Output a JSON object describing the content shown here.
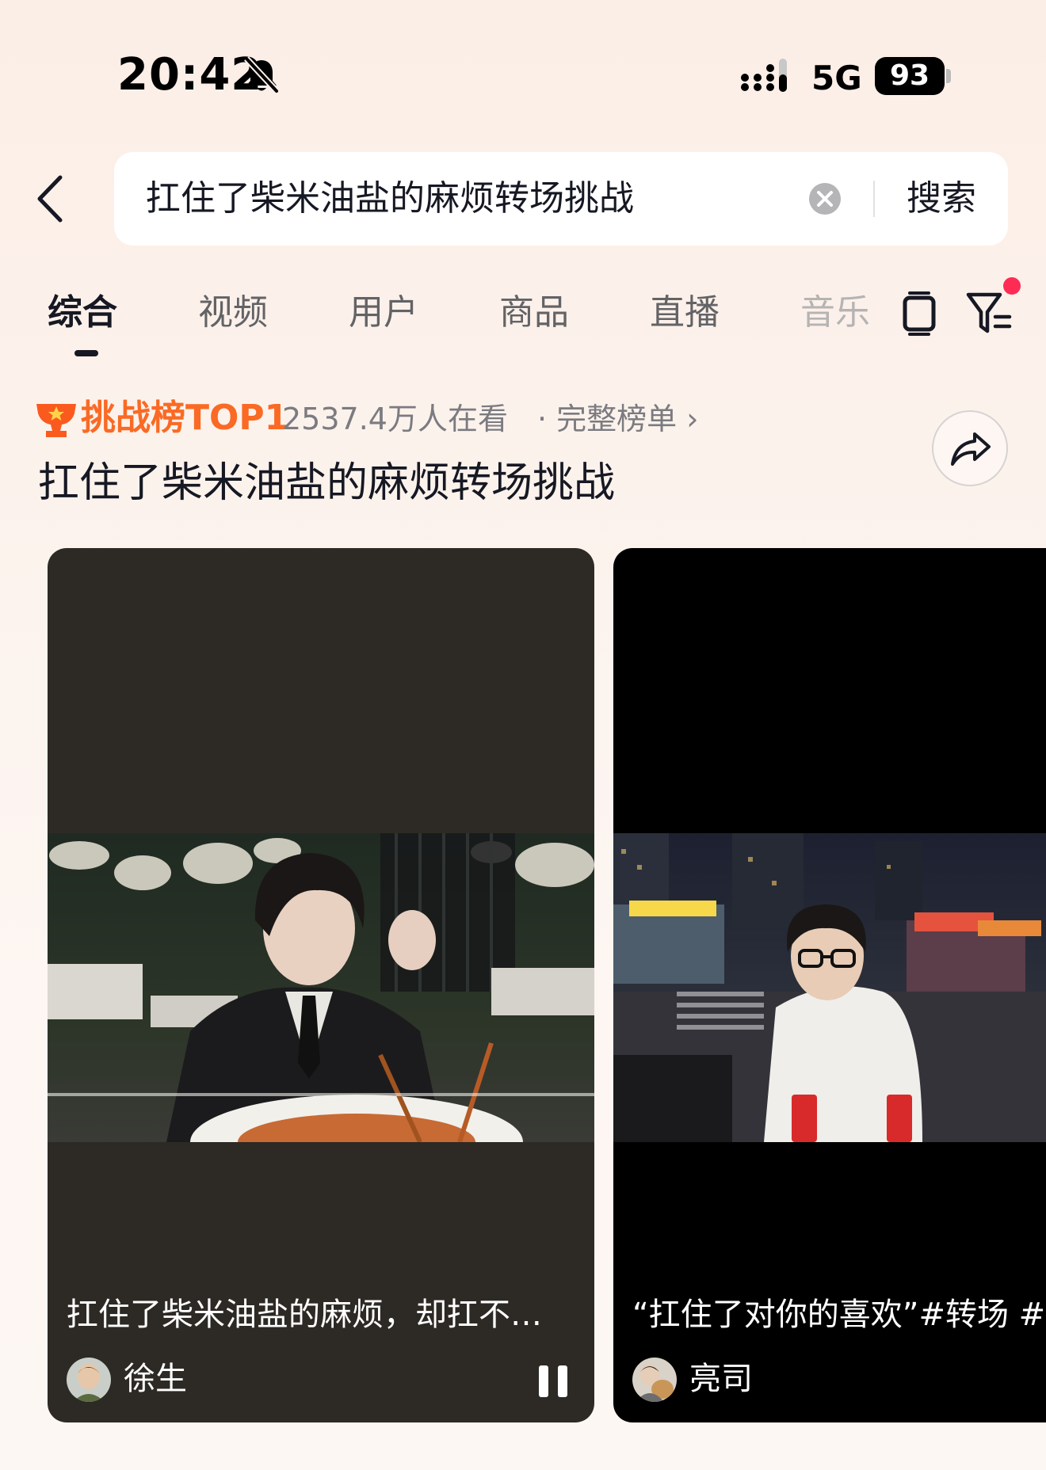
{
  "status_bar": {
    "time": "20:42",
    "network": "5G",
    "battery": "93",
    "icons": [
      "mute-icon",
      "signal-icon",
      "battery-icon"
    ]
  },
  "search": {
    "query": "扛住了柴米油盐的麻烦转场挑战",
    "button_label": "搜索",
    "icons": [
      "back-icon",
      "clear-icon"
    ]
  },
  "tabs": {
    "items": [
      {
        "label": "综合",
        "active": true
      },
      {
        "label": "视频",
        "active": false
      },
      {
        "label": "用户",
        "active": false
      },
      {
        "label": "商品",
        "active": false
      },
      {
        "label": "直播",
        "active": false
      },
      {
        "label": "音乐",
        "active": false
      }
    ],
    "icons": [
      "tablet-icon",
      "filter-icon"
    ],
    "filter_has_badge": true
  },
  "challenge": {
    "rank_label": "挑战榜TOP1",
    "viewer_count": "2537.4万人在看",
    "full_list_link": "· 完整榜单 ›",
    "title": "扛住了柴米油盐的麻烦转场挑战",
    "icons": [
      "trophy-icon",
      "share-icon"
    ]
  },
  "videos": [
    {
      "caption": "扛住了柴米油盐的麻烦，却扛不住...",
      "author": "徐生",
      "state": "playing"
    },
    {
      "caption": "“扛住了对你的喜欢”#转场 #变",
      "author": "亮司"
    }
  ],
  "colors": {
    "accent_orange": "#fa6a24",
    "badge_red": "#fe2c55",
    "text_primary": "#161823",
    "text_secondary": "#7b7b80",
    "card1_bg": "#2d2a25",
    "card2_bg": "#000000"
  }
}
